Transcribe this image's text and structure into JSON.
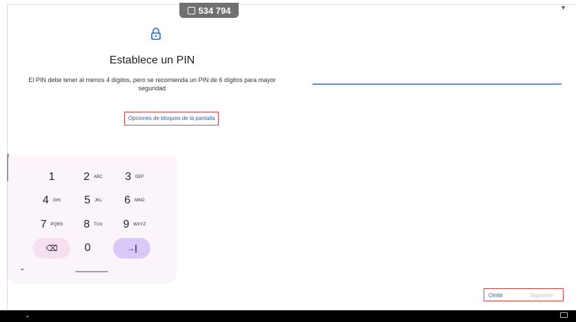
{
  "status_pill": {
    "text": "534 794"
  },
  "page": {
    "title": "Establece un PIN",
    "description": "El PIN debe tener al menos 4 dígitos, pero se recomienda un PIN de 6 dígitos para mayor seguridad",
    "screen_lock_options": "Opciones de bloqueo de la pantalla"
  },
  "keypad": {
    "rows": [
      [
        {
          "digit": "1",
          "letters": ""
        },
        {
          "digit": "2",
          "letters": "ABC"
        },
        {
          "digit": "3",
          "letters": "DEF"
        }
      ],
      [
        {
          "digit": "4",
          "letters": "GHI"
        },
        {
          "digit": "5",
          "letters": "JKL"
        },
        {
          "digit": "6",
          "letters": "MNO"
        }
      ],
      [
        {
          "digit": "7",
          "letters": "PQRS"
        },
        {
          "digit": "8",
          "letters": "TUV"
        },
        {
          "digit": "9",
          "letters": "WXYZ"
        }
      ]
    ],
    "zero": "0",
    "delete_icon": "backspace-icon",
    "next_icon": "tab-next-icon",
    "next_symbol": "→|",
    "delete_symbol": "⌫"
  },
  "footer": {
    "skip": "Omitir",
    "next": "Siguiente"
  },
  "colors": {
    "accent": "#1a66c6",
    "pin_line": "#5a8fd9",
    "highlight_border": "#e04040",
    "keyboard_bg": "#fbf5fb",
    "next_key": "#d9c8f8",
    "delete_key": "#f6dff0"
  }
}
